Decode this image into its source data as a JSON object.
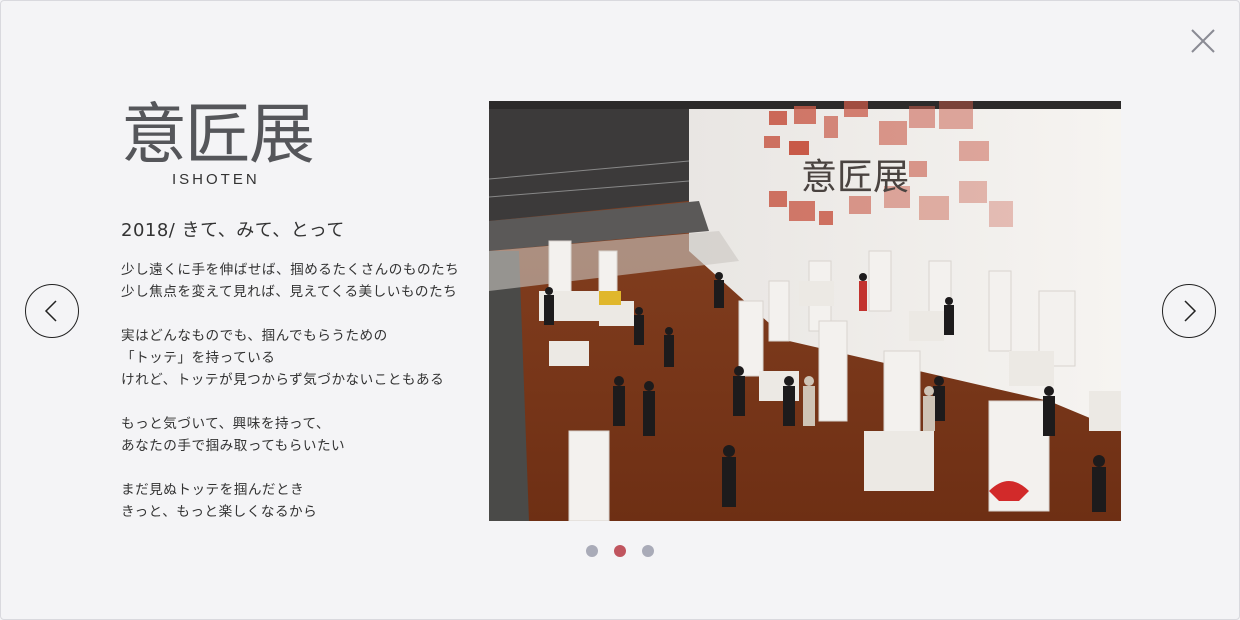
{
  "logo": {
    "kanji": "意匠展",
    "roman": "ISHOTEN"
  },
  "heading": "2018/ きて、みて、とって",
  "paragraphs": [
    "少し遠くに手を伸ばせば、掴めるたくさんのものたち\n少し焦点を変えて見れば、見えてくる美しいものたち",
    "実はどんなものでも、掴んでもらうための\n「トッテ」を持っている\nけれど、トッテが見つからず気づかないこともある",
    "もっと気づいて、興味を持って、\nあなたの手で掴み取ってもらいたい",
    "まだ見ぬトッテを掴んだとき\nきっと、もっと楽しくなるから"
  ],
  "photo": {
    "wall_sign": "意匠展"
  },
  "carousel": {
    "total": 3,
    "active_index": 2
  },
  "icons": {
    "close": "close-icon",
    "prev": "chevron-left-icon",
    "next": "chevron-right-icon"
  },
  "colors": {
    "active_dot": "#c0555f",
    "inactive_dot": "#a9abb8",
    "background": "#f4f4f6"
  }
}
